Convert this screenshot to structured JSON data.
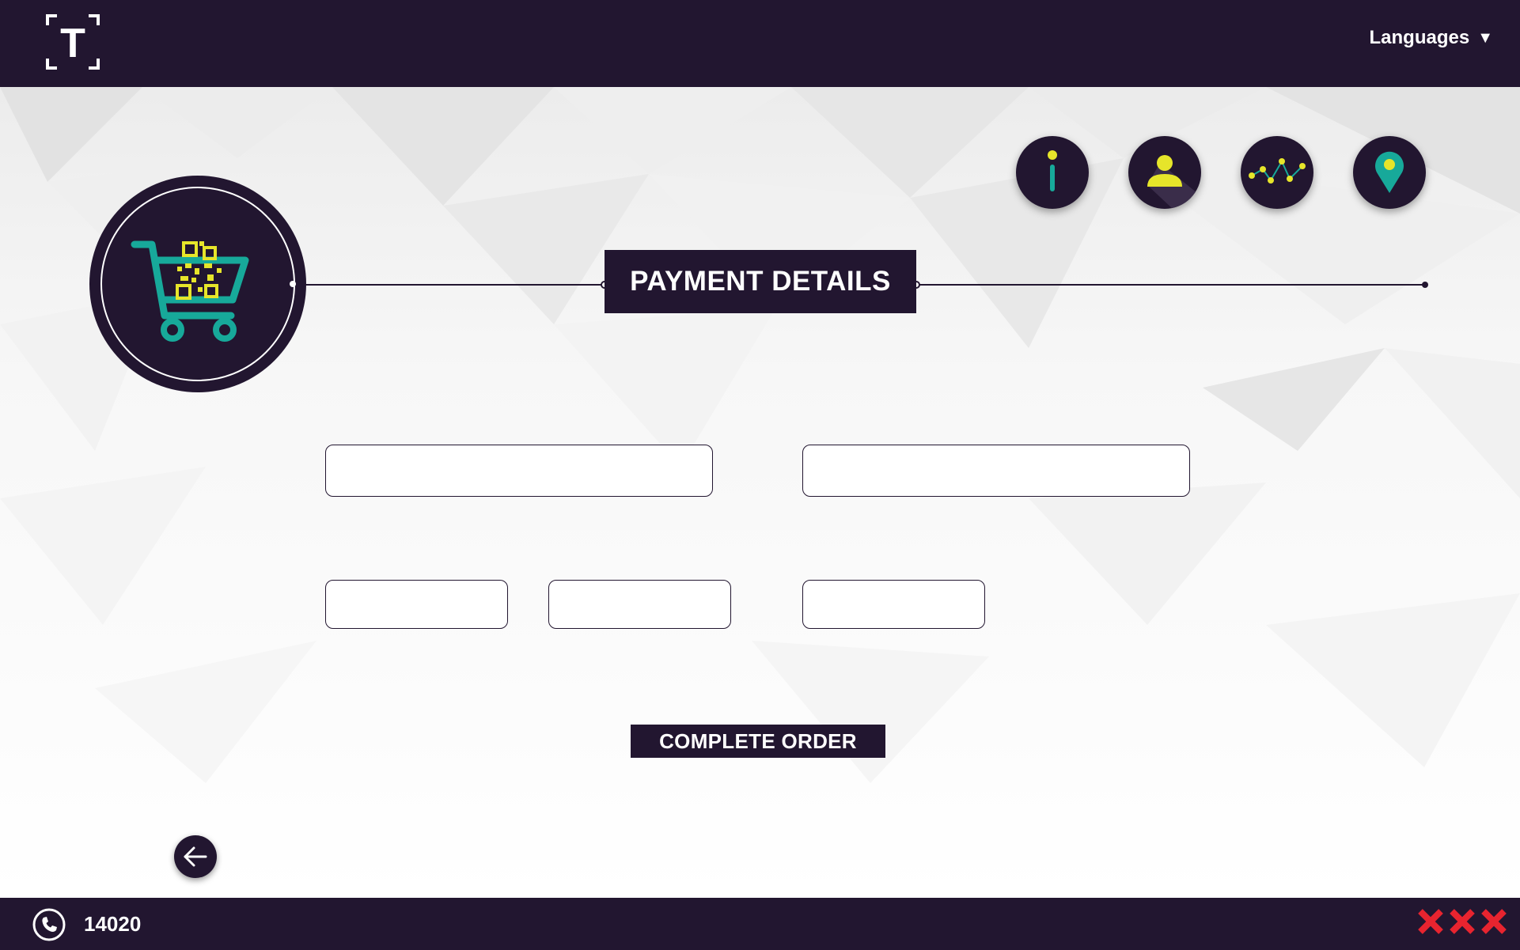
{
  "header": {
    "logo_letter": "T",
    "languages_label": "Languages",
    "languages_caret": "▼"
  },
  "page": {
    "title": "PAYMENT DETAILS",
    "cart_icon": "shopping-cart-qr-icon"
  },
  "nav_icons": [
    {
      "name": "info-icon"
    },
    {
      "name": "user-icon"
    },
    {
      "name": "stats-icon"
    },
    {
      "name": "location-pin-icon"
    }
  ],
  "form": {
    "field1": {
      "value": "",
      "placeholder": ""
    },
    "field2": {
      "value": "",
      "placeholder": ""
    },
    "field3": {
      "value": "",
      "placeholder": ""
    },
    "field4": {
      "value": "",
      "placeholder": ""
    },
    "field5": {
      "value": "",
      "placeholder": ""
    }
  },
  "actions": {
    "complete_order_label": "COMPLETE ORDER",
    "back_icon": "arrow-left-icon"
  },
  "footer": {
    "phone_number": "14020",
    "phone_icon": "phone-icon"
  },
  "colors": {
    "dark": "#221630",
    "teal": "#17a99a",
    "yellow": "#e6e52a",
    "red": "#e8242f"
  }
}
